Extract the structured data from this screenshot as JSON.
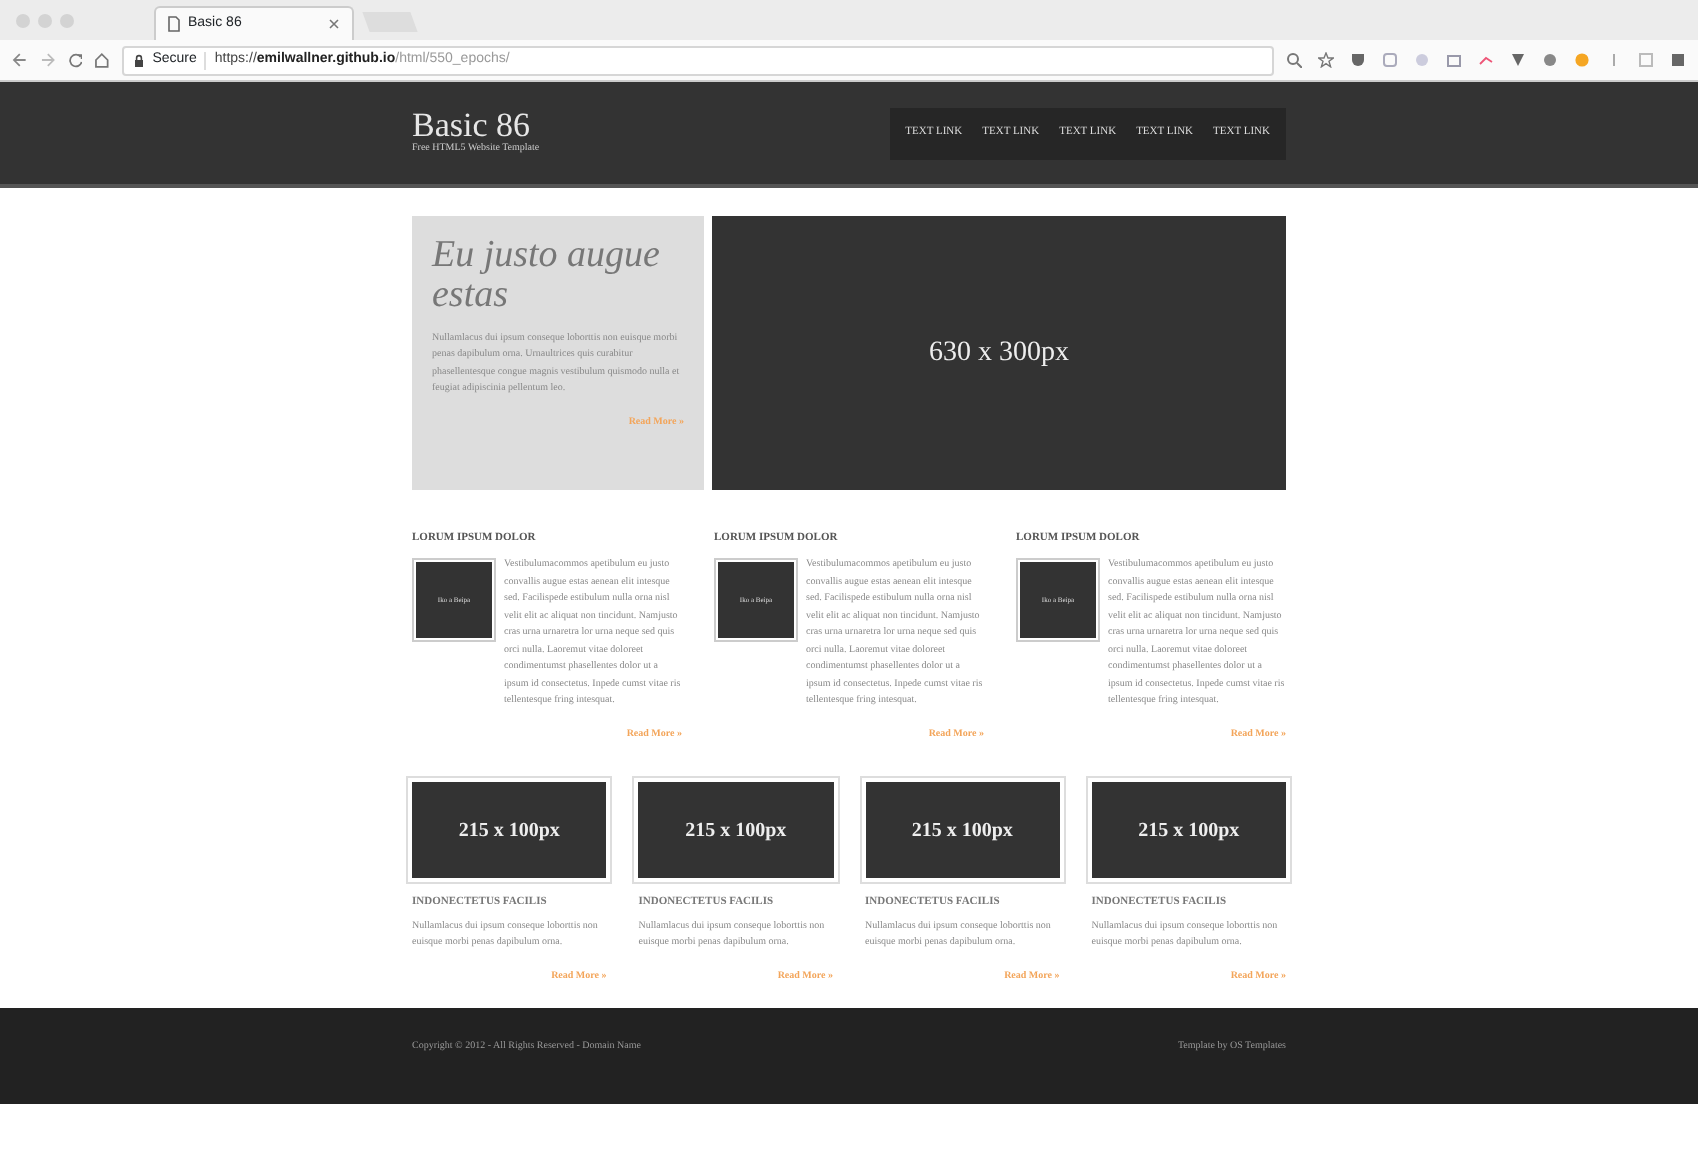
{
  "browser": {
    "tab_title": "Basic 86",
    "secure_label": "Secure",
    "url_scheme": "https://",
    "url_host": "emilwallner.github.io",
    "url_path": "/html/550_epochs/"
  },
  "header": {
    "title": "Basic 86",
    "subtitle": "Free HTML5 Website Template",
    "nav": [
      {
        "label": "TEXT LINK"
      },
      {
        "label": "TEXT LINK"
      },
      {
        "label": "TEXT LINK"
      },
      {
        "label": "TEXT LINK"
      },
      {
        "label": "TEXT LINK"
      }
    ]
  },
  "hero": {
    "heading": "Eu justo augue estas",
    "text": "Nullamlacus dui ipsum conseque loborttis non euisque morbi penas dapibulum orna. Urnaultrices quis curabitur phasellentesque congue magnis vestibulum quismodo nulla et feugiat adipiscinia pellentum leo.",
    "link": "Read More »",
    "image_label": "630 x 300px"
  },
  "columns": [
    {
      "heading": "LORUM IPSUM DOLOR",
      "image_label": "Iko a Beipa",
      "text": "Vestibulumacommos apetibulum eu justo convallis augue estas aenean elit intesque sed. Facilispede estibulum nulla orna nisl velit elit ac aliquat non tincidunt. Namjusto cras urna urnaretra lor urna neque sed quis orci nulla. Laoremut vitae doloreet condimentumst phasellentes dolor ut a ipsum id consectetus. Inpede cumst vitae ris tellentesque fring intesquat.",
      "link": "Read More »"
    },
    {
      "heading": "LORUM IPSUM DOLOR",
      "image_label": "Iko a Beipa",
      "text": "Vestibulumacommos apetibulum eu justo convallis augue estas aenean elit intesque sed. Facilispede estibulum nulla orna nisl velit elit ac aliquat non tincidunt. Namjusto cras urna urnaretra lor urna neque sed quis orci nulla. Laoremut vitae doloreet condimentumst phasellentes dolor ut a ipsum id consectetus. Inpede cumst vitae ris tellentesque fring intesquat.",
      "link": "Read More »"
    },
    {
      "heading": "LORUM IPSUM DOLOR",
      "image_label": "Iko a Beipa",
      "text": "Vestibulumacommos apetibulum eu justo convallis augue estas aenean elit intesque sed. Facilispede estibulum nulla orna nisl velit elit ac aliquat non tincidunt. Namjusto cras urna urnaretra lor urna neque sed quis orci nulla. Laoremut vitae doloreet condimentumst phasellentes dolor ut a ipsum id consectetus. Inpede cumst vitae ris tellentesque fring intesquat.",
      "link": "Read More »"
    }
  ],
  "cards": [
    {
      "image_label": "215 x 100px",
      "heading": "INDONECTETUS FACILIS",
      "text": "Nullamlacus dui ipsum conseque loborttis non euisque morbi penas dapibulum orna.",
      "link": "Read More »"
    },
    {
      "image_label": "215 x 100px",
      "heading": "INDONECTETUS FACILIS",
      "text": "Nullamlacus dui ipsum conseque loborttis non euisque morbi penas dapibulum orna.",
      "link": "Read More »"
    },
    {
      "image_label": "215 x 100px",
      "heading": "INDONECTETUS FACILIS",
      "text": "Nullamlacus dui ipsum conseque loborttis non euisque morbi penas dapibulum orna.",
      "link": "Read More »"
    },
    {
      "image_label": "215 x 100px",
      "heading": "INDONECTETUS FACILIS",
      "text": "Nullamlacus dui ipsum conseque loborttis non euisque morbi penas dapibulum orna.",
      "link": "Read More »"
    }
  ],
  "footer": {
    "copyright": "Copyright © 2012 - All Rights Reserved - Domain Name",
    "credit": "Template by OS Templates"
  }
}
